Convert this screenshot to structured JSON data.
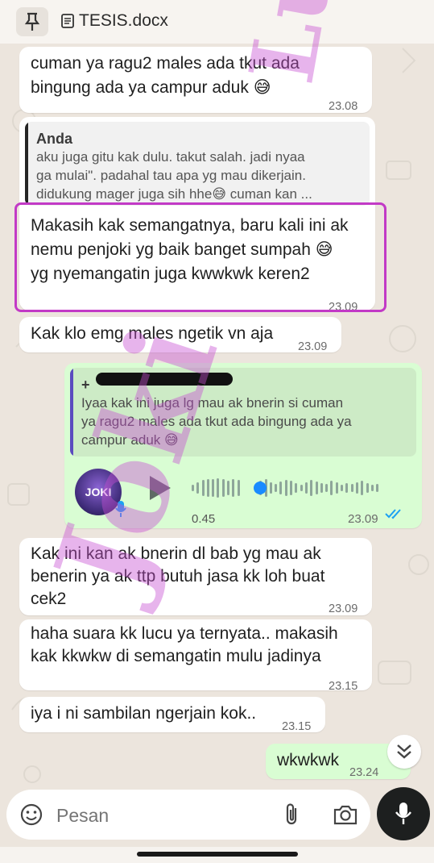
{
  "topbar": {
    "doc_name": "TESIS.docx",
    "pin_icon": "pin-icon",
    "doc_icon": "document-icon"
  },
  "messages": [
    {
      "id": "m1",
      "dir": "in",
      "lines": [
        "cuman ya ragu2 males ada tkut ada",
        "bingung ada ya campur aduk 😅"
      ],
      "time": "23.08"
    },
    {
      "id": "m2",
      "dir": "in",
      "quote": {
        "name": "Anda",
        "text": "aku juga gitu kak dulu. takut salah. jadi nyaa\nga mulai\". padahal tau apa yg mau dikerjain.\ndidukung mager juga sih hhe😅 cuman kan ..."
      },
      "lines": [
        "Makasih kak semangatnya, baru kali ini ak",
        "nemu penjoki yg baik banget sumpah 😅",
        "yg nyemangatin juga kwwkwk keren2"
      ],
      "time": "23.09"
    },
    {
      "id": "m3",
      "dir": "in",
      "lines": [
        "Kak klo emg males ngetik vn aja"
      ],
      "time": "23.09"
    },
    {
      "id": "m4",
      "dir": "out",
      "quote": {
        "name": "+",
        "text": "Iyaa kak ini juga lg mau ak bnerin si cuman\nya ragu2 males ada tkut ada bingung ada ya\ncampur aduk 😅"
      },
      "voice": {
        "duration": "0.45",
        "avatar_label": "JOKI",
        "time": "23.09"
      }
    },
    {
      "id": "m5",
      "dir": "in",
      "lines": [
        "Kak ini kan ak bnerin dl bab yg mau ak",
        "benerin ya ak ttp butuh jasa kk loh buat",
        "cek2"
      ],
      "time": "23.09"
    },
    {
      "id": "m6",
      "dir": "in",
      "lines": [
        "haha suara kk lucu ya ternyata.. makasih",
        "kak kkwkw di semangatin mulu jadinya"
      ],
      "time": "23.15"
    },
    {
      "id": "m7",
      "dir": "in",
      "lines": [
        "iya i ni sambilan ngerjain kok.."
      ],
      "time": "23.15"
    },
    {
      "id": "m8",
      "dir": "out",
      "lines": [
        "wkwkwk"
      ],
      "time": "23.24"
    }
  ],
  "composer": {
    "placeholder": "Pesan",
    "emoji_icon": "emoji-icon",
    "attach_icon": "paperclip-icon",
    "camera_icon": "camera-icon",
    "mic_icon": "microphone-icon"
  },
  "watermark": {
    "top": "Lucy",
    "bottom": "Joki"
  },
  "colors": {
    "accent": "#c23ac6",
    "outgoing": "#d9fdd3",
    "incoming": "#ffffff",
    "read_tick": "#1da1f2"
  }
}
